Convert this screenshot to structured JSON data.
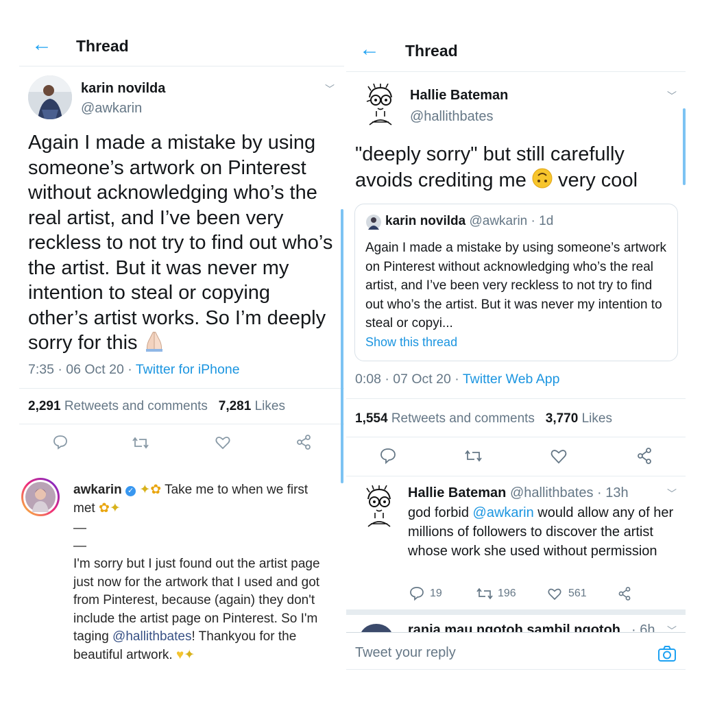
{
  "left": {
    "header": {
      "title": "Thread"
    },
    "tweet": {
      "name": "karin novilda",
      "handle": "@awkarin",
      "text": "Again I made a mistake by using someone’s artwork on Pinterest without acknowledging who’s the real artist, and I’ve been very reckless to not try to find out who’s the artist. But it was never my intention to steal or copying other’s artist works. So I’m deeply sorry for this",
      "time": "7:35 · 06 Oct 20 · ",
      "client": "Twitter for iPhone",
      "retweets_count": "2,291",
      "retweets_label": "Retweets and comments",
      "likes_count": "7,281",
      "likes_label": "Likes"
    },
    "instagram": {
      "username": "awkarin",
      "caption_start": "Take me to when we first met",
      "dash1": "—",
      "dash2": "—",
      "body": "I'm sorry but I just found out the artist page just now for the artwork that I used and got from Pinterest, because (again) they don't include the artist page on Pinterest. So I'm taging ",
      "mention": "@hallithbates",
      "body_end": "! Thankyou for the beautiful artwork."
    }
  },
  "right": {
    "header": {
      "title": "Thread"
    },
    "tweet": {
      "name": "Hallie Bateman",
      "handle": "@hallithbates",
      "text_start": "\"deeply sorry\" but still carefully avoids crediting me",
      "text_end": "very cool",
      "time": "0:08 · 07 Oct 20 · ",
      "client": "Twitter Web App",
      "retweets_count": "1,554",
      "retweets_label": "Retweets and comments",
      "likes_count": "3,770",
      "likes_label": "Likes"
    },
    "quote": {
      "name": "karin novilda",
      "handle_time": "@awkarin · 1d",
      "text": "Again I made a mistake by using someone’s artwork on Pinterest without acknowledging who’s the real artist, and I’ve been very reckless to not try to find out who’s the artist. But it was never my intention to steal or copyi...",
      "show_thread": "Show this thread"
    },
    "reply": {
      "name": "Hallie Bateman",
      "handle_time": "@hallithbates · 13h",
      "text_start": "god forbid ",
      "mention": "@awkarin",
      "text_end": " would allow any of her millions of followers to discover the artist whose work she used without permission",
      "replies": "19",
      "retweets": "196",
      "likes": "561"
    },
    "next_reply": {
      "partial": "rania mau ngotoh sambil ngotoh",
      "time": "· 6h"
    },
    "compose": {
      "placeholder": "Tweet your reply"
    }
  },
  "colors": {
    "twitter_blue": "#1da1f2",
    "link": "#1b95e0",
    "muted": "#657786",
    "border": "#e6ecf0"
  }
}
